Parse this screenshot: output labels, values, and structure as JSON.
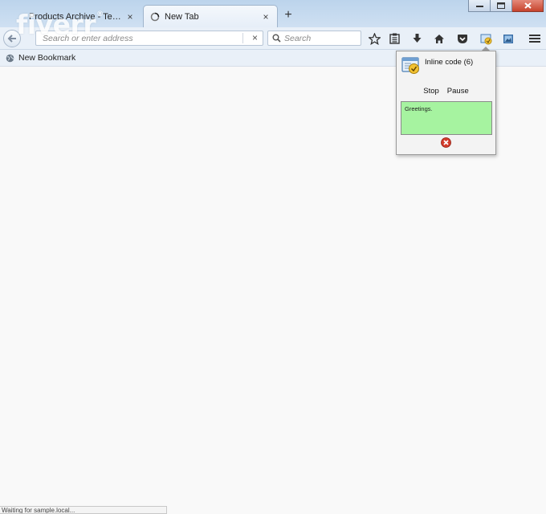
{
  "watermark": {
    "brand": "fiverr",
    "mark": "®"
  },
  "tabs": [
    {
      "title": "Products Archive - Test Ba...",
      "active": false,
      "close_glyph": "×"
    },
    {
      "title": "New Tab",
      "active": true,
      "close_glyph": "×"
    }
  ],
  "newtab_glyph": "+",
  "navbar": {
    "url_placeholder": "Search or enter address",
    "url_clear_glyph": "×",
    "search_placeholder": "Search"
  },
  "toolbar_icons": [
    "star-icon",
    "reading-list-icon",
    "download-icon",
    "home-icon",
    "pocket-icon",
    "addon-inline-code-icon",
    "screenshot-icon",
    "menu-icon"
  ],
  "bookmarks": {
    "items": [
      {
        "label": "New Bookmark"
      }
    ]
  },
  "popup": {
    "title": "Inline code (6)",
    "stop_label": "Stop",
    "pause_label": "Pause",
    "message": "Greetings."
  },
  "status": {
    "text": "Waiting for sample.local..."
  },
  "colors": {
    "tabstrip": "#c7dbef",
    "toolbar": "#e9f0f8",
    "popup_message_bg": "#a6f3a0",
    "close_red": "#d33b2b"
  }
}
